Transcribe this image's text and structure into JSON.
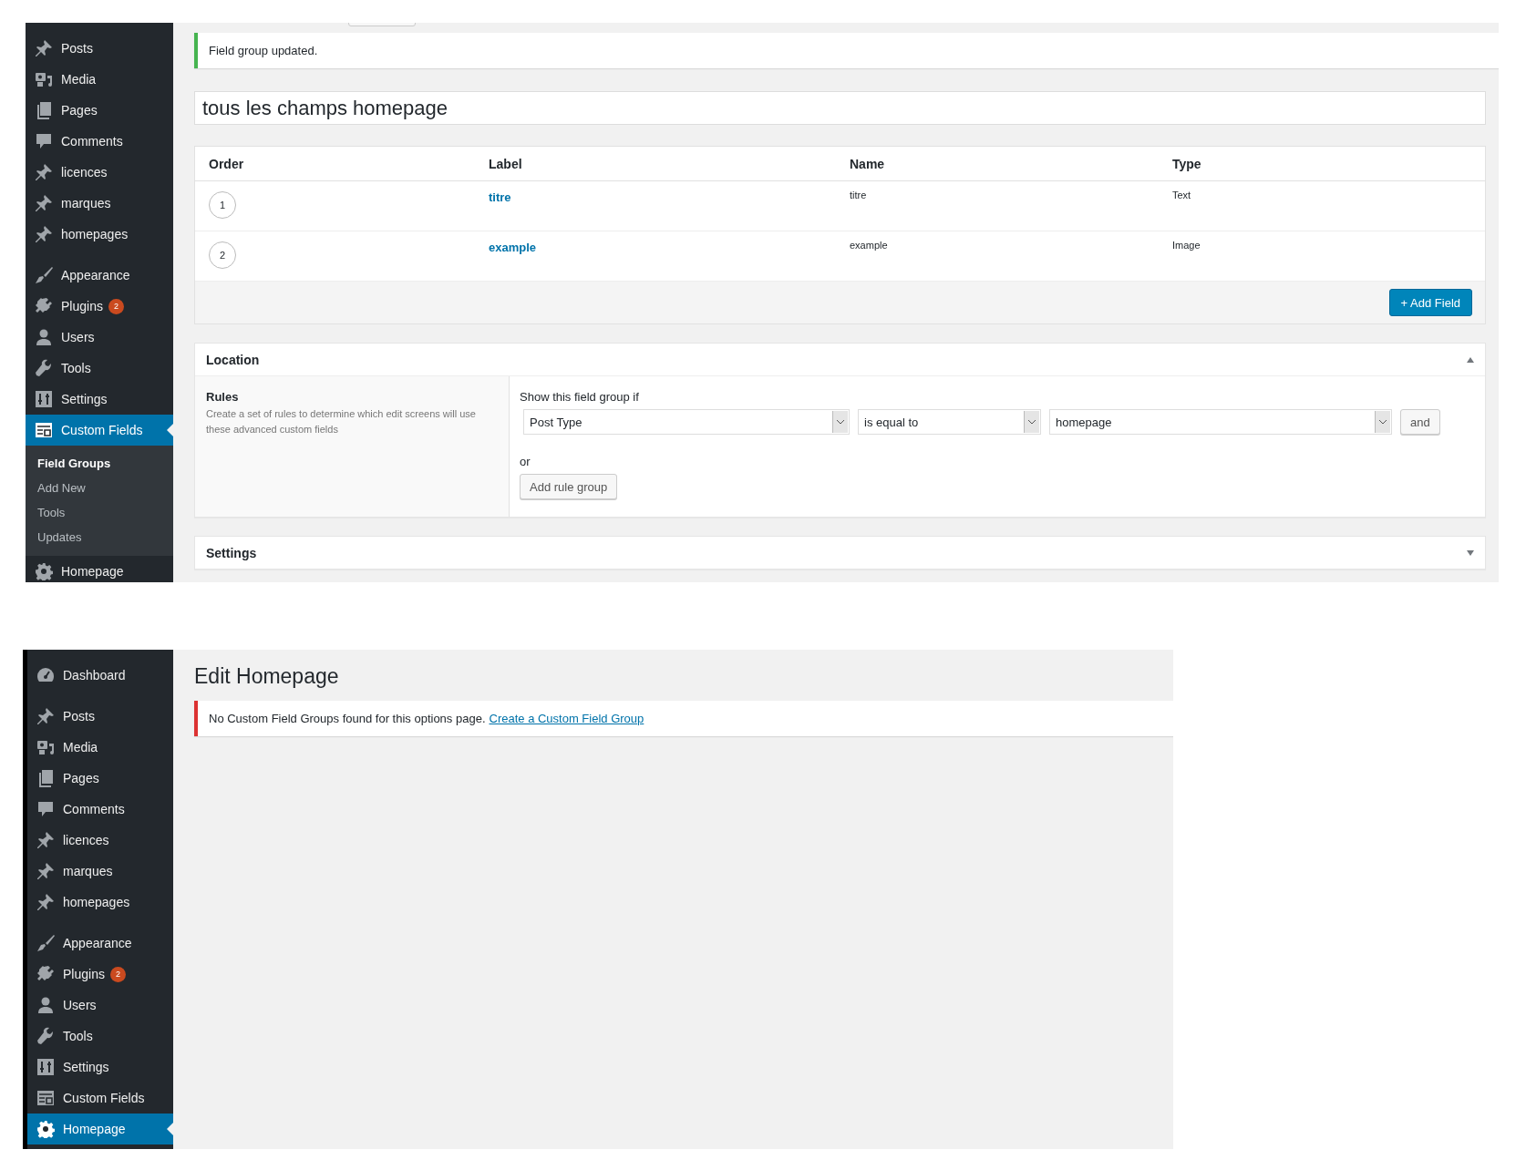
{
  "field_group_screen": {
    "sidebar": {
      "groups": [
        [
          {
            "label": "Posts",
            "kind": "pin",
            "selected": false
          },
          {
            "label": "Media",
            "kind": "media",
            "selected": false
          },
          {
            "label": "Pages",
            "kind": "pages",
            "selected": false
          },
          {
            "label": "Comments",
            "kind": "comment",
            "selected": false
          },
          {
            "label": "licences",
            "kind": "pin",
            "selected": false
          },
          {
            "label": "marques",
            "kind": "pin",
            "selected": false
          },
          {
            "label": "homepages",
            "kind": "pin",
            "selected": false
          }
        ],
        [
          {
            "label": "Appearance",
            "kind": "brush",
            "selected": false
          },
          {
            "label": "Plugins",
            "kind": "plug",
            "selected": false,
            "badge": "2"
          },
          {
            "label": "Users",
            "kind": "user",
            "selected": false
          },
          {
            "label": "Tools",
            "kind": "wrench",
            "selected": false
          },
          {
            "label": "Settings",
            "kind": "sliders",
            "selected": false
          },
          {
            "label": "Custom Fields",
            "kind": "table",
            "selected": true,
            "submenu": [
              {
                "label": "Field Groups",
                "selected": true
              },
              {
                "label": "Add New",
                "selected": false
              },
              {
                "label": "Tools",
                "selected": false
              },
              {
                "label": "Updates",
                "selected": false
              }
            ]
          },
          {
            "label": "Homepage",
            "kind": "gear",
            "selected": false
          }
        ]
      ]
    },
    "notice": {
      "kind": "success",
      "text": "Field group updated."
    },
    "title_field": {
      "value": "tous les champs homepage"
    },
    "fields_table": {
      "columns": [
        "Order",
        "Label",
        "Name",
        "Type"
      ],
      "rows": [
        {
          "order": "1",
          "label": "titre",
          "name": "titre",
          "type": "Text"
        },
        {
          "order": "2",
          "label": "example",
          "name": "example",
          "type": "Image"
        }
      ],
      "add_button": "+ Add Field"
    },
    "location_box": {
      "title": "Location",
      "expanded": true,
      "rules_title": "Rules",
      "rules_description": "Create a set of rules to determine which edit screens will use these advanced custom fields",
      "condition_heading": "Show this field group if",
      "rule": [
        "Post Type",
        "is equal to",
        "homepage"
      ],
      "and_button": "and",
      "or_label": "or",
      "add_group_button": "Add rule group"
    },
    "settings_box": {
      "title": "Settings",
      "expanded": false
    }
  },
  "options_screen": {
    "sidebar": {
      "groups": [
        [
          {
            "label": "Dashboard",
            "kind": "dashboard",
            "selected": false
          }
        ],
        [
          {
            "label": "Posts",
            "kind": "pin",
            "selected": false
          },
          {
            "label": "Media",
            "kind": "media",
            "selected": false
          },
          {
            "label": "Pages",
            "kind": "pages",
            "selected": false
          },
          {
            "label": "Comments",
            "kind": "comment",
            "selected": false
          },
          {
            "label": "licences",
            "kind": "pin",
            "selected": false
          },
          {
            "label": "marques",
            "kind": "pin",
            "selected": false
          },
          {
            "label": "homepages",
            "kind": "pin",
            "selected": false
          }
        ],
        [
          {
            "label": "Appearance",
            "kind": "brush",
            "selected": false
          },
          {
            "label": "Plugins",
            "kind": "plug",
            "selected": false,
            "badge": "2"
          },
          {
            "label": "Users",
            "kind": "user",
            "selected": false
          },
          {
            "label": "Tools",
            "kind": "wrench",
            "selected": false
          },
          {
            "label": "Settings",
            "kind": "sliders",
            "selected": false
          },
          {
            "label": "Custom Fields",
            "kind": "table",
            "selected": false
          },
          {
            "label": "Homepage",
            "kind": "gear",
            "selected": true
          }
        ]
      ]
    },
    "heading": "Edit Homepage",
    "notice": {
      "kind": "error",
      "text": "No Custom Field Groups found for this options page.",
      "link": "Create a Custom Field Group"
    }
  }
}
